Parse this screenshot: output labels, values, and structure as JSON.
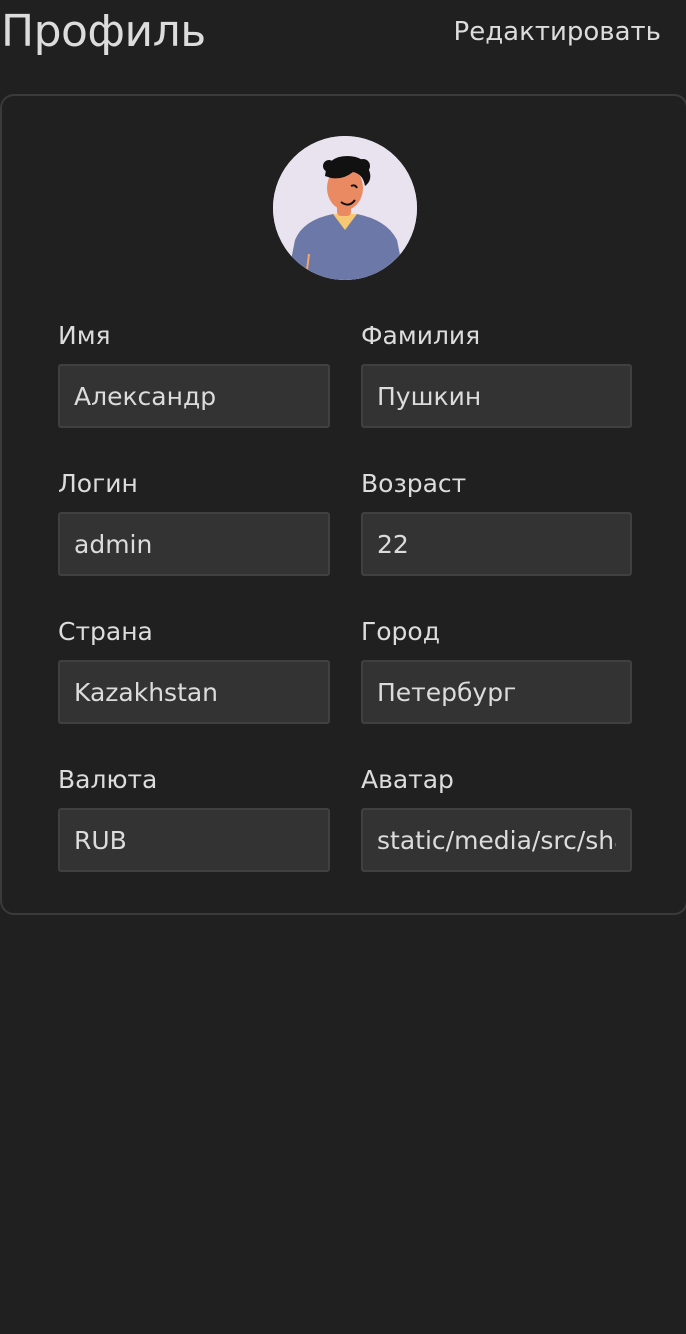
{
  "header": {
    "title": "Профиль",
    "edit_label": "Редактировать"
  },
  "profile": {
    "avatar_icon": "user-avatar-illustration",
    "fields": {
      "first_name": {
        "label": "Имя",
        "value": "Александр"
      },
      "last_name": {
        "label": "Фамилия",
        "value": "Пушкин"
      },
      "username": {
        "label": "Логин",
        "value": "admin"
      },
      "age": {
        "label": "Возраст",
        "value": "22"
      },
      "country": {
        "label": "Страна",
        "value": "Kazakhstan"
      },
      "city": {
        "label": "Город",
        "value": "Петербург"
      },
      "currency": {
        "label": "Валюта",
        "value": "RUB"
      },
      "avatar": {
        "label": "Аватар",
        "value": "static/media/src/shared/assets/tests/storybook.jpg"
      }
    }
  },
  "colors": {
    "background": "#202020",
    "card_border": "#3a3a3a",
    "input_bg": "#333333",
    "text": "#dcdcdc",
    "avatar_bg": "#e9e3f0",
    "avatar_shirt": "#6b78a8"
  }
}
